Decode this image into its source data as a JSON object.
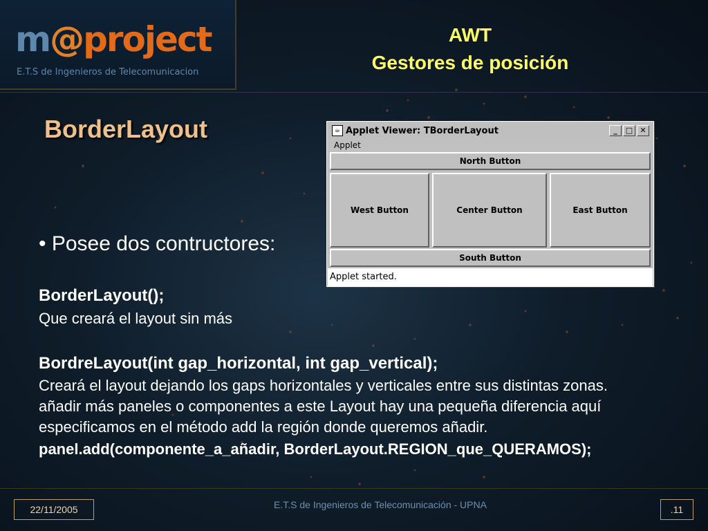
{
  "logo": {
    "m": "m",
    "at": "@",
    "rest": "project",
    "subtitle": "E.T.S de Ingenieros de Telecomunicacion"
  },
  "header": {
    "line1": "AWT",
    "line2": "Gestores de posición"
  },
  "section_title": "BorderLayout",
  "bullet": "• Posee dos contructores:",
  "constructor1": {
    "code": "BorderLayout();",
    "desc": "Que creará el layout sin más"
  },
  "constructor2": {
    "code": "BordreLayout(int gap_horizontal, int gap_vertical);",
    "lines": [
      "Creará el layout dejando los gaps horizontales y verticales entre sus distintas zonas.",
      " añadir más paneles o componentes a este Layout hay una pequeña diferencia aquí",
      "especificamos en el método add la región donde queremos añadir."
    ],
    "example": "panel.add(componente_a_añadir, BorderLayout.REGION_que_QUERAMOS);"
  },
  "applet": {
    "title": "Applet Viewer: TBorderLayout",
    "menu": "Applet",
    "north": "North Button",
    "west": "West Button",
    "center": "Center Button",
    "east": "East Button",
    "south": "South Button",
    "status": "Applet started.",
    "min": "_",
    "max": "□",
    "close": "✕"
  },
  "footer": {
    "date": "22/11/2005",
    "center": "E.T.S de Ingenieros de Telecomunicación - UPNA",
    "page": ".11"
  },
  "colors": {
    "title_yellow": "#ffff66",
    "section_orange": "#f0c08a",
    "logo_orange": "#e26a18",
    "logo_blue": "#5d87ad"
  }
}
